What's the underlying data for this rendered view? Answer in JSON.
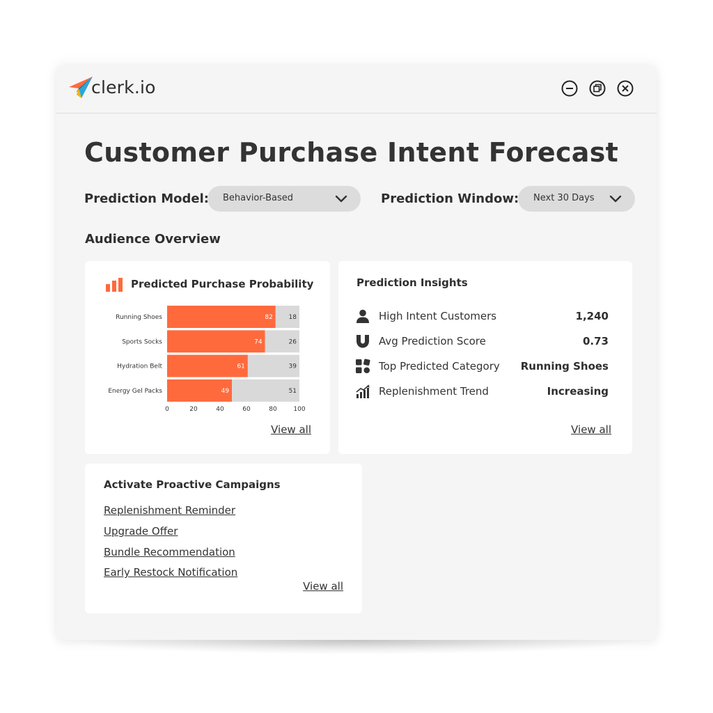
{
  "app": {
    "brand": "clerk.io",
    "logo_icon": "paper-plane-logo-icon",
    "window_controls": [
      "minimize-icon",
      "restore-icon",
      "close-icon"
    ]
  },
  "page": {
    "title": "Customer Purchase Intent Forecast"
  },
  "filters": {
    "model_label": "Prediction Model:",
    "model_value": "Behavior-Based",
    "window_label": "Prediction Window:",
    "window_value": "Next 30 Days"
  },
  "audience": {
    "section_title": "Audience Overview"
  },
  "probability_card": {
    "title": "Predicted Purchase Probability",
    "icon": "bar-chart-icon",
    "view_all": "View all"
  },
  "chart_data": {
    "type": "bar",
    "orientation": "horizontal",
    "stacked": true,
    "categories": [
      "Running Shoes",
      "Sports Socks",
      "Hydration Belt",
      "Energy Gel Packs"
    ],
    "series": [
      {
        "values": [
          82,
          74,
          61,
          49
        ],
        "color": "#ff6a3d"
      },
      {
        "values": [
          18,
          26,
          39,
          51
        ],
        "color": "#d9d9d9"
      }
    ],
    "x_ticks": [
      "0",
      "20",
      "40",
      "60",
      "80",
      "100"
    ],
    "xlim": [
      0,
      100
    ],
    "grid": false
  },
  "insights_card": {
    "title": "Prediction Insights",
    "rows": [
      {
        "icon": "person-icon",
        "label": "High Intent Customers",
        "value": "1,240"
      },
      {
        "icon": "magnet-icon",
        "label": "Avg Prediction Score",
        "value": "0.73"
      },
      {
        "icon": "category-grid-icon",
        "label": "Top Predicted Category",
        "value": "Running Shoes"
      },
      {
        "icon": "trend-chart-icon",
        "label": "Replenishment Trend",
        "value": "Increasing"
      }
    ],
    "view_all": "View all"
  },
  "campaigns_card": {
    "title": "Activate Proactive Campaigns",
    "links": [
      "Replenishment Reminder",
      "Upgrade Offer",
      "Bundle Recommendation",
      "Early Restock Notification"
    ],
    "view_all": "View all"
  },
  "colors": {
    "accent": "#ff6a3d",
    "bar_remainder": "#d9d9d9",
    "window_bg": "#f5f5f5",
    "card_bg": "#ffffff",
    "dropdown_bg": "#dcdcdc"
  }
}
